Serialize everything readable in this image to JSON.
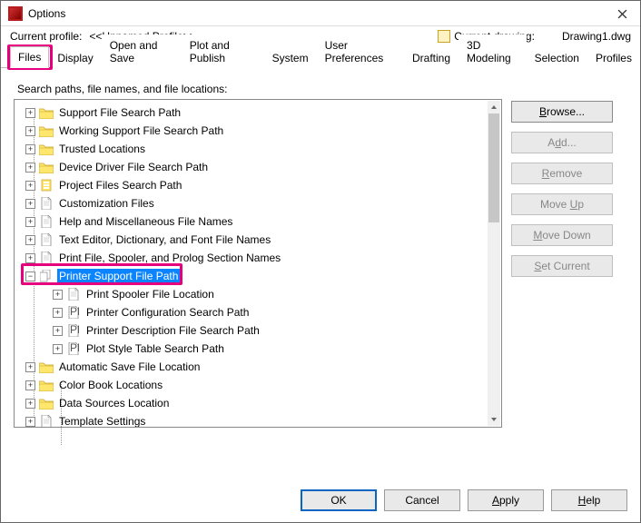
{
  "title": "Options",
  "profile_label": "Current profile:",
  "profile_value": "<<Unnamed Profile>>",
  "drawing_label": "Current drawing:",
  "drawing_value": "Drawing1.dwg",
  "tabs": [
    "Files",
    "Display",
    "Open and Save",
    "Plot and Publish",
    "System",
    "User Preferences",
    "Drafting",
    "3D Modeling",
    "Selection",
    "Profiles"
  ],
  "section_label": "Search paths, file names, and file locations:",
  "tree": [
    {
      "icon": "folder",
      "label": "Support File Search Path",
      "lvl": 1,
      "exp": "+"
    },
    {
      "icon": "folder",
      "label": "Working Support File Search Path",
      "lvl": 1,
      "exp": "+"
    },
    {
      "icon": "folder",
      "label": "Trusted Locations",
      "lvl": 1,
      "exp": "+"
    },
    {
      "icon": "folder",
      "label": "Device Driver File Search Path",
      "lvl": 1,
      "exp": "+"
    },
    {
      "icon": "proj",
      "label": "Project Files Search Path",
      "lvl": 1,
      "exp": "+"
    },
    {
      "icon": "page",
      "label": "Customization Files",
      "lvl": 1,
      "exp": "+"
    },
    {
      "icon": "page",
      "label": "Help and Miscellaneous File Names",
      "lvl": 1,
      "exp": "+"
    },
    {
      "icon": "page",
      "label": "Text Editor, Dictionary, and Font File Names",
      "lvl": 1,
      "exp": "+"
    },
    {
      "icon": "page",
      "label": "Print File, Spooler, and Prolog Section Names",
      "lvl": 1,
      "exp": "+"
    },
    {
      "icon": "copy",
      "label": "Printer Support File Path",
      "lvl": 1,
      "exp": "−",
      "selected": true
    },
    {
      "icon": "page",
      "label": "Print Spooler File Location",
      "lvl": 2,
      "exp": "+"
    },
    {
      "icon": "plt",
      "label": "Printer Configuration Search Path",
      "lvl": 2,
      "exp": "+"
    },
    {
      "icon": "plt",
      "label": "Printer Description File Search Path",
      "lvl": 2,
      "exp": "+"
    },
    {
      "icon": "plt",
      "label": "Plot Style Table Search Path",
      "lvl": 2,
      "exp": "+"
    },
    {
      "icon": "folder",
      "label": "Automatic Save File Location",
      "lvl": 1,
      "exp": "+"
    },
    {
      "icon": "folder",
      "label": "Color Book Locations",
      "lvl": 1,
      "exp": "+"
    },
    {
      "icon": "folder",
      "label": "Data Sources Location",
      "lvl": 1,
      "exp": "+"
    },
    {
      "icon": "page",
      "label": "Template Settings",
      "lvl": 1,
      "exp": "+"
    }
  ],
  "side_buttons": {
    "browse": "Browse...",
    "add": "Add...",
    "remove": "Remove",
    "moveup": "Move Up",
    "movedown": "Move Down",
    "setcurrent": "Set Current"
  },
  "bottom_buttons": {
    "ok": "OK",
    "cancel": "Cancel",
    "apply": "Apply",
    "help": "Help"
  }
}
